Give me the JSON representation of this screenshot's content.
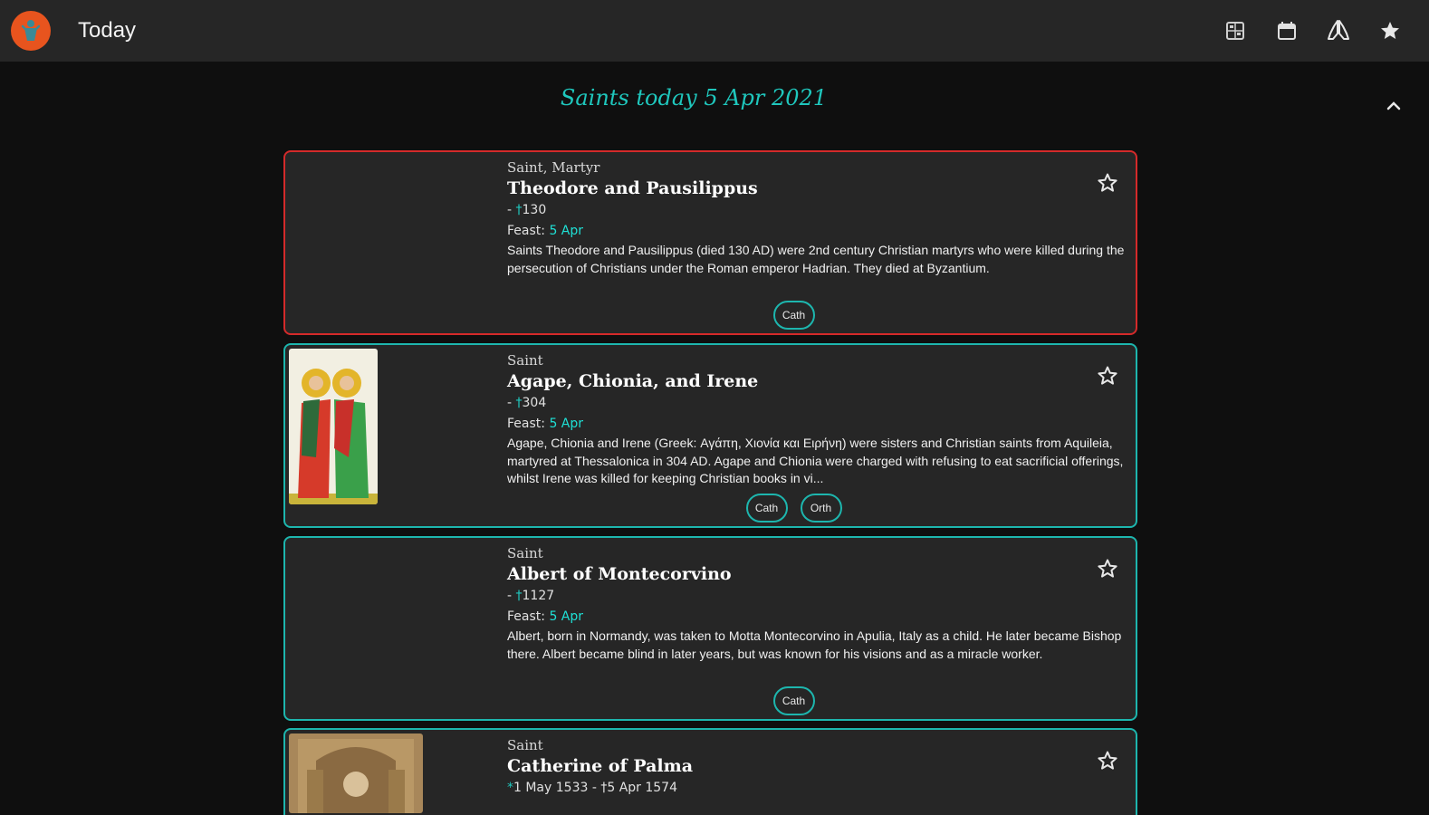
{
  "appbar": {
    "title": "Today",
    "icons": [
      "calendar-grid-icon",
      "calendar-icon",
      "praying-hands-icon",
      "star-icon"
    ]
  },
  "heading": "Saints today 5 Apr 2021",
  "colors": {
    "accent": "#1fc7bd",
    "card_border": "#1db6ae",
    "special_border": "#d42a2a",
    "logo": "#e8541e"
  },
  "cards": [
    {
      "category": "Saint, Martyr",
      "name": "Theodore and Pausilippus",
      "dates_prefix": "- ",
      "dates_cross": "†",
      "dates_rest": "130",
      "feast_label": "Feast:",
      "feast_date": "5 Apr",
      "description": "Saints Theodore and Pausilippus (died 130 AD) were 2nd century Christian martyrs who were killed during the persecution of Christians under the Roman emperor Hadrian. They died at Byzantium.",
      "tags": [
        "Cath"
      ]
    },
    {
      "category": "Saint",
      "name": "Agape, Chionia, and Irene",
      "dates_prefix": "- ",
      "dates_cross": "†",
      "dates_rest": "304",
      "feast_label": "Feast:",
      "feast_date": "5 Apr",
      "description": "Agape, Chionia and Irene (Greek: Αγάπη, Χιονία και Ειρήνη) were sisters and Christian saints from Aquileia, martyred at Thessalonica in 304 AD. Agape and Chionia were charged with refusing to eat sacrificial offerings, whilst Irene was killed for keeping Christian books in vi...",
      "tags": [
        "Cath",
        "Orth"
      ]
    },
    {
      "category": "Saint",
      "name": "Albert of Montecorvino",
      "dates_prefix": "- ",
      "dates_cross": "†",
      "dates_rest": "1127",
      "feast_label": "Feast:",
      "feast_date": "5 Apr",
      "description": "Albert, born in Normandy, was taken to Motta Montecorvino in Apulia, Italy as a child. He later became Bishop there. Albert became blind in later years, but was known for his visions and as a miracle worker.",
      "tags": [
        "Cath"
      ]
    },
    {
      "category": "Saint",
      "name": "Catherine of Palma",
      "dates_prefix": "",
      "dates_cross": "*",
      "dates_rest": "1 May 1533 - †5 Apr 1574",
      "feast_label": "",
      "feast_date": "",
      "description": "",
      "tags": []
    }
  ]
}
